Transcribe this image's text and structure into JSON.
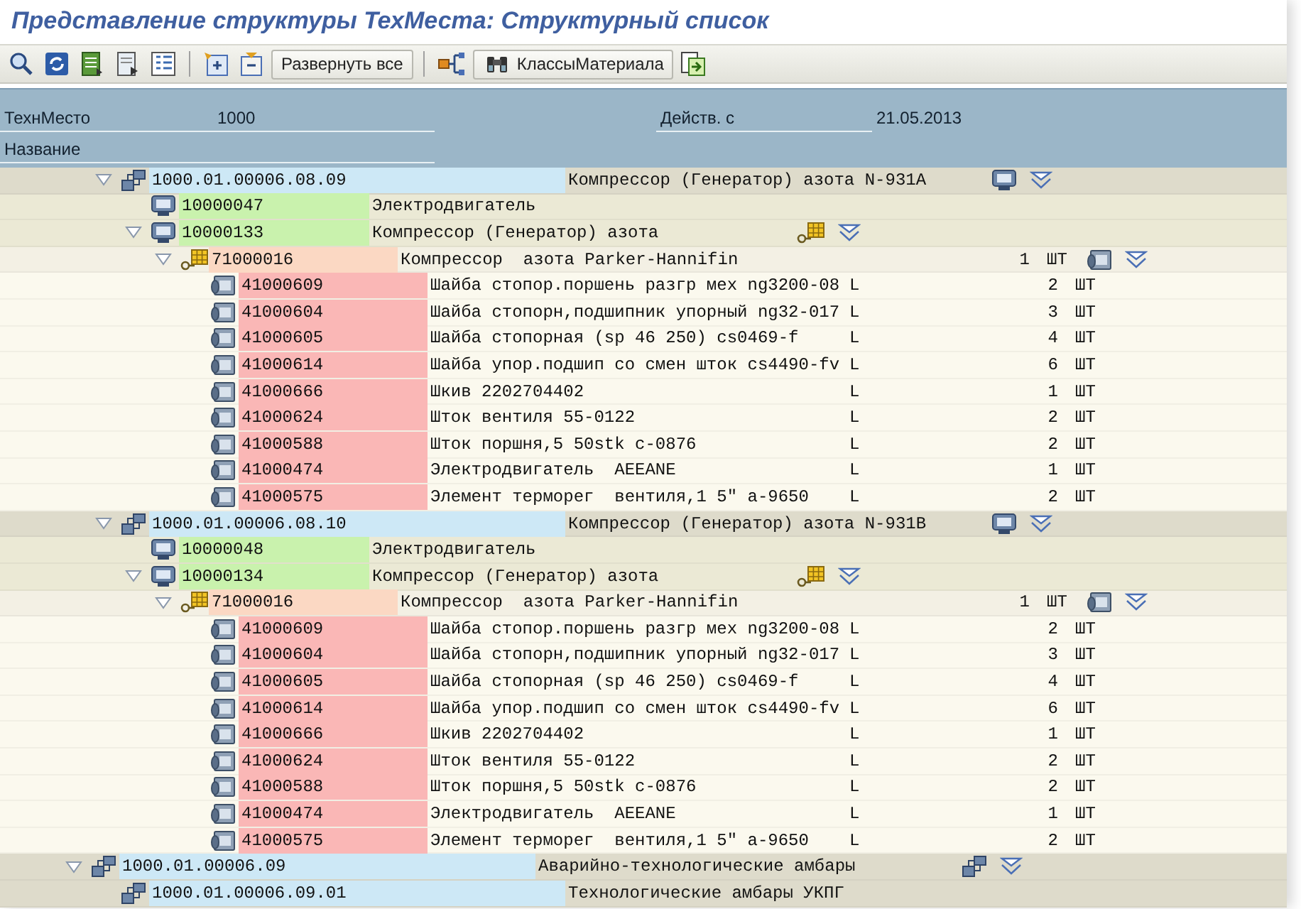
{
  "window": {
    "title": "Представление структуры ТехМеста: Структурный список"
  },
  "toolbar": {
    "buttons": [
      "Развернуть все",
      "КлассыМатериала"
    ]
  },
  "header": {
    "rows": [
      [
        {
          "label": "ТехнМесто",
          "value": "1000"
        },
        {
          "label": "Действ. с",
          "value": "21.05.2013"
        }
      ],
      [
        {
          "label": "Название"
        }
      ]
    ]
  },
  "tree": [
    {
      "kind": "offscreen",
      "children": [
        {
          "kind": "floc",
          "id": "1000.01.00006.08.09",
          "description": "Компрессор (Генератор) азота N-931A",
          "expanded": true,
          "children": [
            {
              "kind": "equipment",
              "id": "10000047",
              "description": "Электродвигатель"
            },
            {
              "kind": "equipment",
              "id": "10000133",
              "description": "Компрессор (Генератор) азота",
              "expanded": true,
              "children": [
                {
                  "kind": "bom",
                  "id": "71000016",
                  "description": "Компрессор  азота Parker-Hannifin",
                  "quantity": "1",
                  "unit": "ШТ",
                  "expanded": true,
                  "children": [
                    {
                      "kind": "material",
                      "id": "41000609",
                      "description": "Шайба стопор.поршень разгр мех ng3200-08",
                      "item_category": "L",
                      "quantity": "2",
                      "unit": "ШТ"
                    },
                    {
                      "kind": "material",
                      "id": "41000604",
                      "description": "Шайба стопорн,подшипник упорный ng32-017",
                      "item_category": "L",
                      "quantity": "3",
                      "unit": "ШТ"
                    },
                    {
                      "kind": "material",
                      "id": "41000605",
                      "description": "Шайба стопорная (sp 46 250) cs0469-f",
                      "item_category": "L",
                      "quantity": "4",
                      "unit": "ШТ"
                    },
                    {
                      "kind": "material",
                      "id": "41000614",
                      "description": "Шайба упор.подшип со смен шток cs4490-fv",
                      "item_category": "L",
                      "quantity": "6",
                      "unit": "ШТ"
                    },
                    {
                      "kind": "material",
                      "id": "41000666",
                      "description": "Шкив 2202704402",
                      "item_category": "L",
                      "quantity": "1",
                      "unit": "ШТ"
                    },
                    {
                      "kind": "material",
                      "id": "41000624",
                      "description": "Шток вентиля 55-0122",
                      "item_category": "L",
                      "quantity": "2",
                      "unit": "ШТ"
                    },
                    {
                      "kind": "material",
                      "id": "41000588",
                      "description": "Шток поршня,5 50stk c-0876",
                      "item_category": "L",
                      "quantity": "2",
                      "unit": "ШТ"
                    },
                    {
                      "kind": "material",
                      "id": "41000474",
                      "description": "Электродвигатель  AEEANE",
                      "item_category": "L",
                      "quantity": "1",
                      "unit": "ШТ"
                    },
                    {
                      "kind": "material",
                      "id": "41000575",
                      "description": "Элемент терморег  вентиля,1 5\" a-9650",
                      "item_category": "L",
                      "quantity": "2",
                      "unit": "ШТ"
                    }
                  ]
                }
              ]
            }
          ]
        },
        {
          "kind": "floc",
          "id": "1000.01.00006.08.10",
          "description": "Компрессор (Генератор) азота N-931B",
          "expanded": true,
          "children": [
            {
              "kind": "equipment",
              "id": "10000048",
              "description": "Электродвигатель"
            },
            {
              "kind": "equipment",
              "id": "10000134",
              "description": "Компрессор (Генератор) азота",
              "expanded": true,
              "children": [
                {
                  "kind": "bom",
                  "id": "71000016",
                  "description": "Компрессор  азота Parker-Hannifin",
                  "quantity": "1",
                  "unit": "ШТ",
                  "expanded": true,
                  "children": [
                    {
                      "kind": "material",
                      "id": "41000609",
                      "description": "Шайба стопор.поршень разгр мех ng3200-08",
                      "item_category": "L",
                      "quantity": "2",
                      "unit": "ШТ"
                    },
                    {
                      "kind": "material",
                      "id": "41000604",
                      "description": "Шайба стопорн,подшипник упорный ng32-017",
                      "item_category": "L",
                      "quantity": "3",
                      "unit": "ШТ"
                    },
                    {
                      "kind": "material",
                      "id": "41000605",
                      "description": "Шайба стопорная (sp 46 250) cs0469-f",
                      "item_category": "L",
                      "quantity": "4",
                      "unit": "ШТ"
                    },
                    {
                      "kind": "material",
                      "id": "41000614",
                      "description": "Шайба упор.подшип со смен шток cs4490-fv",
                      "item_category": "L",
                      "quantity": "6",
                      "unit": "ШТ"
                    },
                    {
                      "kind": "material",
                      "id": "41000666",
                      "description": "Шкив 2202704402",
                      "item_category": "L",
                      "quantity": "1",
                      "unit": "ШТ"
                    },
                    {
                      "kind": "material",
                      "id": "41000624",
                      "description": "Шток вентиля 55-0122",
                      "item_category": "L",
                      "quantity": "2",
                      "unit": "ШТ"
                    },
                    {
                      "kind": "material",
                      "id": "41000588",
                      "description": "Шток поршня,5 50stk c-0876",
                      "item_category": "L",
                      "quantity": "2",
                      "unit": "ШТ"
                    },
                    {
                      "kind": "material",
                      "id": "41000474",
                      "description": "Электродвигатель  AEEANE",
                      "item_category": "L",
                      "quantity": "1",
                      "unit": "ШТ"
                    },
                    {
                      "kind": "material",
                      "id": "41000575",
                      "description": "Элемент терморег  вентиля,1 5\" a-9650",
                      "item_category": "L",
                      "quantity": "2",
                      "unit": "ШТ"
                    }
                  ]
                }
              ]
            }
          ]
        }
      ]
    },
    {
      "kind": "floc",
      "id": "1000.01.00006.09",
      "description": "Аварийно-технологические амбары",
      "expanded": true,
      "children": [
        {
          "kind": "floc",
          "id": "1000.01.00006.09.01",
          "description": "Технологические амбары УКПГ"
        }
      ]
    }
  ]
}
